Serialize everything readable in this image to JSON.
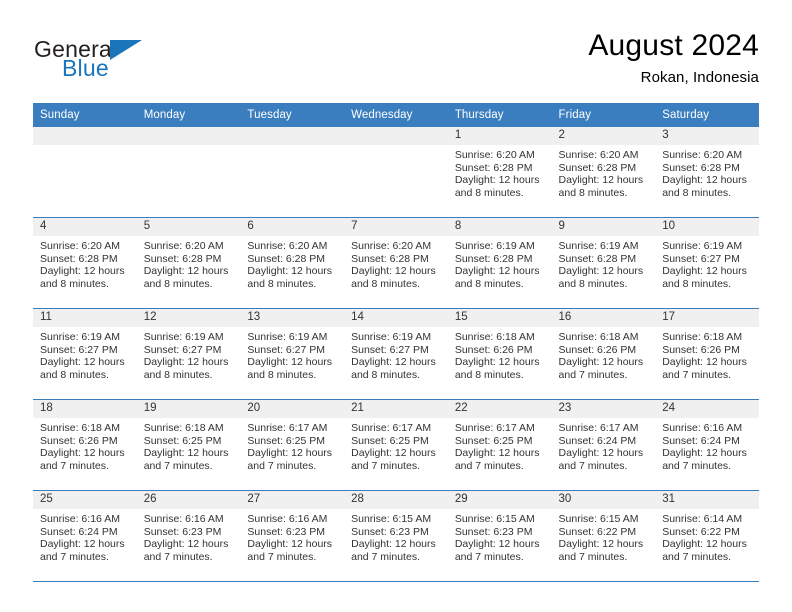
{
  "logo": {
    "word1": "General",
    "word2": "Blue",
    "triangle_color": "#1b75bb",
    "triangle_icon": "triangle-icon"
  },
  "header": {
    "title": "August 2024",
    "subtitle": "Rokan, Indonesia"
  },
  "theme": {
    "header_blue": "#3a7ebf",
    "daynum_band": "#f0f0f0",
    "text": "#333333"
  },
  "weekdays": [
    "Sunday",
    "Monday",
    "Tuesday",
    "Wednesday",
    "Thursday",
    "Friday",
    "Saturday"
  ],
  "weeks": [
    [
      {
        "day": "",
        "sunrise": "",
        "sunset": "",
        "daylight1": "",
        "daylight2": ""
      },
      {
        "day": "",
        "sunrise": "",
        "sunset": "",
        "daylight1": "",
        "daylight2": ""
      },
      {
        "day": "",
        "sunrise": "",
        "sunset": "",
        "daylight1": "",
        "daylight2": ""
      },
      {
        "day": "",
        "sunrise": "",
        "sunset": "",
        "daylight1": "",
        "daylight2": ""
      },
      {
        "day": "1",
        "sunrise": "Sunrise: 6:20 AM",
        "sunset": "Sunset: 6:28 PM",
        "daylight1": "Daylight: 12 hours",
        "daylight2": "and 8 minutes."
      },
      {
        "day": "2",
        "sunrise": "Sunrise: 6:20 AM",
        "sunset": "Sunset: 6:28 PM",
        "daylight1": "Daylight: 12 hours",
        "daylight2": "and 8 minutes."
      },
      {
        "day": "3",
        "sunrise": "Sunrise: 6:20 AM",
        "sunset": "Sunset: 6:28 PM",
        "daylight1": "Daylight: 12 hours",
        "daylight2": "and 8 minutes."
      }
    ],
    [
      {
        "day": "4",
        "sunrise": "Sunrise: 6:20 AM",
        "sunset": "Sunset: 6:28 PM",
        "daylight1": "Daylight: 12 hours",
        "daylight2": "and 8 minutes."
      },
      {
        "day": "5",
        "sunrise": "Sunrise: 6:20 AM",
        "sunset": "Sunset: 6:28 PM",
        "daylight1": "Daylight: 12 hours",
        "daylight2": "and 8 minutes."
      },
      {
        "day": "6",
        "sunrise": "Sunrise: 6:20 AM",
        "sunset": "Sunset: 6:28 PM",
        "daylight1": "Daylight: 12 hours",
        "daylight2": "and 8 minutes."
      },
      {
        "day": "7",
        "sunrise": "Sunrise: 6:20 AM",
        "sunset": "Sunset: 6:28 PM",
        "daylight1": "Daylight: 12 hours",
        "daylight2": "and 8 minutes."
      },
      {
        "day": "8",
        "sunrise": "Sunrise: 6:19 AM",
        "sunset": "Sunset: 6:28 PM",
        "daylight1": "Daylight: 12 hours",
        "daylight2": "and 8 minutes."
      },
      {
        "day": "9",
        "sunrise": "Sunrise: 6:19 AM",
        "sunset": "Sunset: 6:28 PM",
        "daylight1": "Daylight: 12 hours",
        "daylight2": "and 8 minutes."
      },
      {
        "day": "10",
        "sunrise": "Sunrise: 6:19 AM",
        "sunset": "Sunset: 6:27 PM",
        "daylight1": "Daylight: 12 hours",
        "daylight2": "and 8 minutes."
      }
    ],
    [
      {
        "day": "11",
        "sunrise": "Sunrise: 6:19 AM",
        "sunset": "Sunset: 6:27 PM",
        "daylight1": "Daylight: 12 hours",
        "daylight2": "and 8 minutes."
      },
      {
        "day": "12",
        "sunrise": "Sunrise: 6:19 AM",
        "sunset": "Sunset: 6:27 PM",
        "daylight1": "Daylight: 12 hours",
        "daylight2": "and 8 minutes."
      },
      {
        "day": "13",
        "sunrise": "Sunrise: 6:19 AM",
        "sunset": "Sunset: 6:27 PM",
        "daylight1": "Daylight: 12 hours",
        "daylight2": "and 8 minutes."
      },
      {
        "day": "14",
        "sunrise": "Sunrise: 6:19 AM",
        "sunset": "Sunset: 6:27 PM",
        "daylight1": "Daylight: 12 hours",
        "daylight2": "and 8 minutes."
      },
      {
        "day": "15",
        "sunrise": "Sunrise: 6:18 AM",
        "sunset": "Sunset: 6:26 PM",
        "daylight1": "Daylight: 12 hours",
        "daylight2": "and 8 minutes."
      },
      {
        "day": "16",
        "sunrise": "Sunrise: 6:18 AM",
        "sunset": "Sunset: 6:26 PM",
        "daylight1": "Daylight: 12 hours",
        "daylight2": "and 7 minutes."
      },
      {
        "day": "17",
        "sunrise": "Sunrise: 6:18 AM",
        "sunset": "Sunset: 6:26 PM",
        "daylight1": "Daylight: 12 hours",
        "daylight2": "and 7 minutes."
      }
    ],
    [
      {
        "day": "18",
        "sunrise": "Sunrise: 6:18 AM",
        "sunset": "Sunset: 6:26 PM",
        "daylight1": "Daylight: 12 hours",
        "daylight2": "and 7 minutes."
      },
      {
        "day": "19",
        "sunrise": "Sunrise: 6:18 AM",
        "sunset": "Sunset: 6:25 PM",
        "daylight1": "Daylight: 12 hours",
        "daylight2": "and 7 minutes."
      },
      {
        "day": "20",
        "sunrise": "Sunrise: 6:17 AM",
        "sunset": "Sunset: 6:25 PM",
        "daylight1": "Daylight: 12 hours",
        "daylight2": "and 7 minutes."
      },
      {
        "day": "21",
        "sunrise": "Sunrise: 6:17 AM",
        "sunset": "Sunset: 6:25 PM",
        "daylight1": "Daylight: 12 hours",
        "daylight2": "and 7 minutes."
      },
      {
        "day": "22",
        "sunrise": "Sunrise: 6:17 AM",
        "sunset": "Sunset: 6:25 PM",
        "daylight1": "Daylight: 12 hours",
        "daylight2": "and 7 minutes."
      },
      {
        "day": "23",
        "sunrise": "Sunrise: 6:17 AM",
        "sunset": "Sunset: 6:24 PM",
        "daylight1": "Daylight: 12 hours",
        "daylight2": "and 7 minutes."
      },
      {
        "day": "24",
        "sunrise": "Sunrise: 6:16 AM",
        "sunset": "Sunset: 6:24 PM",
        "daylight1": "Daylight: 12 hours",
        "daylight2": "and 7 minutes."
      }
    ],
    [
      {
        "day": "25",
        "sunrise": "Sunrise: 6:16 AM",
        "sunset": "Sunset: 6:24 PM",
        "daylight1": "Daylight: 12 hours",
        "daylight2": "and 7 minutes."
      },
      {
        "day": "26",
        "sunrise": "Sunrise: 6:16 AM",
        "sunset": "Sunset: 6:23 PM",
        "daylight1": "Daylight: 12 hours",
        "daylight2": "and 7 minutes."
      },
      {
        "day": "27",
        "sunrise": "Sunrise: 6:16 AM",
        "sunset": "Sunset: 6:23 PM",
        "daylight1": "Daylight: 12 hours",
        "daylight2": "and 7 minutes."
      },
      {
        "day": "28",
        "sunrise": "Sunrise: 6:15 AM",
        "sunset": "Sunset: 6:23 PM",
        "daylight1": "Daylight: 12 hours",
        "daylight2": "and 7 minutes."
      },
      {
        "day": "29",
        "sunrise": "Sunrise: 6:15 AM",
        "sunset": "Sunset: 6:23 PM",
        "daylight1": "Daylight: 12 hours",
        "daylight2": "and 7 minutes."
      },
      {
        "day": "30",
        "sunrise": "Sunrise: 6:15 AM",
        "sunset": "Sunset: 6:22 PM",
        "daylight1": "Daylight: 12 hours",
        "daylight2": "and 7 minutes."
      },
      {
        "day": "31",
        "sunrise": "Sunrise: 6:14 AM",
        "sunset": "Sunset: 6:22 PM",
        "daylight1": "Daylight: 12 hours",
        "daylight2": "and 7 minutes."
      }
    ]
  ]
}
